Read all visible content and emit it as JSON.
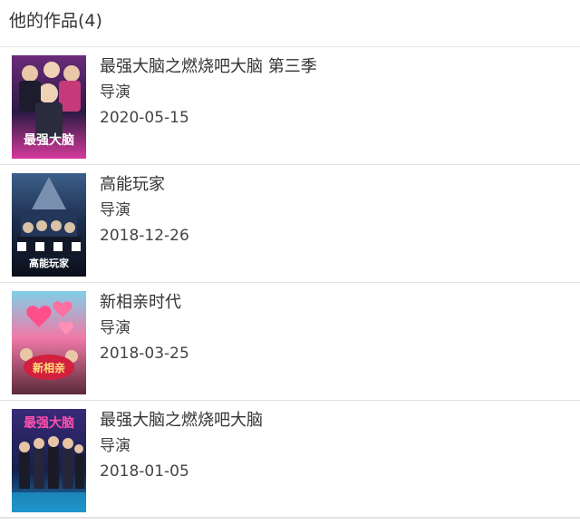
{
  "header": {
    "title": "他的作品(4)"
  },
  "works": [
    {
      "title": "最强大脑之燃烧吧大脑 第三季",
      "role": "导演",
      "date": "2020-05-15",
      "poster_icon": "poster-image",
      "poster_text": "最强大脑",
      "poster_colors": [
        "#6b2b7a",
        "#d63a9b",
        "#2a1a44"
      ]
    },
    {
      "title": "高能玩家",
      "role": "导演",
      "date": "2018-12-26",
      "poster_icon": "poster-image",
      "poster_text": "高能玩家",
      "poster_colors": [
        "#1b2b4a",
        "#3c5f8a",
        "#0a0f1a"
      ]
    },
    {
      "title": "新相亲时代",
      "role": "导演",
      "date": "2018-03-25",
      "poster_icon": "poster-image",
      "poster_text": "新相亲",
      "poster_colors": [
        "#f07aa8",
        "#e83a5a",
        "#5b2a3a"
      ]
    },
    {
      "title": "最强大脑之燃烧吧大脑",
      "role": "导演",
      "date": "2018-01-05",
      "poster_icon": "poster-image",
      "poster_text": "最强大脑",
      "poster_colors": [
        "#3a2a78",
        "#d0308e",
        "#15204a"
      ]
    }
  ]
}
